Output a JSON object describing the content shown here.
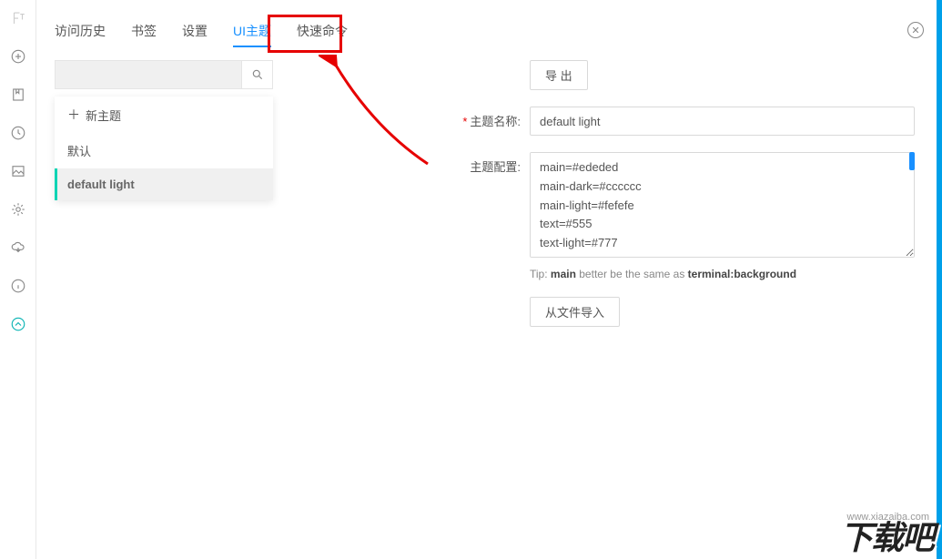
{
  "sidebar": {
    "items": [
      {
        "name": "logo-icon"
      },
      {
        "name": "plus-circle-icon"
      },
      {
        "name": "bookmark-icon"
      },
      {
        "name": "clock-icon"
      },
      {
        "name": "image-icon"
      },
      {
        "name": "gear-icon"
      },
      {
        "name": "cloud-download-icon"
      },
      {
        "name": "info-icon"
      },
      {
        "name": "sync-icon"
      }
    ]
  },
  "tabs": {
    "items": [
      "访问历史",
      "书签",
      "设置",
      "UI主题",
      "快速命令"
    ],
    "active_index": 3
  },
  "left": {
    "search_placeholder": "",
    "new_theme_label": "新主题",
    "items": [
      "默认",
      "default light"
    ],
    "selected_index": 1
  },
  "form": {
    "export_btn": "导 出",
    "name_label": "主题名称:",
    "name_value": "default light",
    "config_label": "主题配置:",
    "config_value": "main=#ededed\nmain-dark=#cccccc\nmain-light=#fefefe\ntext=#555\ntext-light=#777",
    "tip_prefix": "Tip: ",
    "tip_bold1": "main",
    "tip_mid": " better be the same as ",
    "tip_bold2": "terminal:background",
    "import_btn": "从文件导入"
  },
  "watermark": {
    "url": "www.xiazaiba.com",
    "text": "下载吧"
  }
}
